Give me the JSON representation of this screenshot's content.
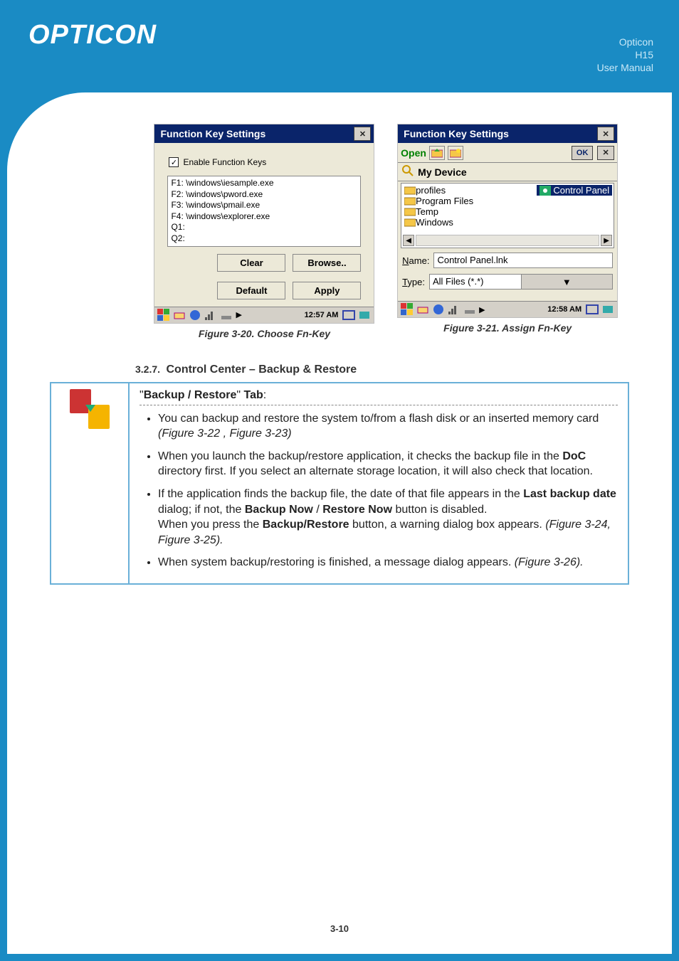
{
  "header": {
    "logo": "OPTICON",
    "brand": "Opticon",
    "model": "H15",
    "doctype": "User Manual"
  },
  "fig1": {
    "title": "Function Key Settings",
    "checkbox_label": "Enable Function Keys",
    "list": [
      "F1: \\windows\\iesample.exe",
      "F2: \\windows\\pword.exe",
      "F3: \\windows\\pmail.exe",
      "F4: \\windows\\explorer.exe",
      "Q1:",
      "Q2:"
    ],
    "clear": "Clear",
    "browse": "Browse..",
    "default": "Default",
    "apply": "Apply",
    "clock": "12:57 AM",
    "caption": "Figure 3-20. Choose Fn-Key"
  },
  "fig2": {
    "title": "Function Key Settings",
    "open": "Open",
    "ok": "OK",
    "mydevice": "My Device",
    "folders": [
      "profiles",
      "Program Files",
      "Temp",
      "Windows"
    ],
    "controlpanel": "Control Panel",
    "name_label": "Name:",
    "name_value": "Control Panel.lnk",
    "type_label": "Type:",
    "type_value": "All Files (*.*)",
    "clock": "12:58 AM",
    "caption": "Figure 3-21. Assign Fn-Key"
  },
  "section": {
    "num": "3.2.7.",
    "title": "Control Center – Backup & Restore",
    "tab_header": "\"Backup / Restore\" Tab:",
    "bullets": [
      {
        "html_parts": [
          {
            "t": "You can backup and restore the system to/from a flash disk or an inserted memory card "
          },
          {
            "t": "(Figure 3-22 , Figure 3-23)",
            "i": true
          }
        ]
      },
      {
        "html_parts": [
          {
            "t": "When you launch the backup/restore application, it checks the backup file in the "
          },
          {
            "t": "DoC",
            "b": true
          },
          {
            "t": " directory first. If you select an alternate storage location, it will also check that location."
          }
        ]
      },
      {
        "html_parts": [
          {
            "t": "If the application finds the backup file, the date of that file appears in the "
          },
          {
            "t": "Last backup date",
            "b": true
          },
          {
            "t": " dialog; if not, the "
          },
          {
            "t": "Backup Now",
            "b": true
          },
          {
            "t": " / "
          },
          {
            "t": "Restore Now",
            "b": true
          },
          {
            "t": " button is disabled.\nWhen you press the "
          },
          {
            "t": "Backup/Restore",
            "b": true
          },
          {
            "t": " button, a warning dialog box appears. "
          },
          {
            "t": "(Figure 3-24, Figure 3-25).",
            "i": true
          }
        ]
      },
      {
        "html_parts": [
          {
            "t": "When system backup/restoring is finished, a message dialog appears. "
          },
          {
            "t": "(Figure 3-26).",
            "i": true
          }
        ]
      }
    ]
  },
  "page_number": "3-10"
}
